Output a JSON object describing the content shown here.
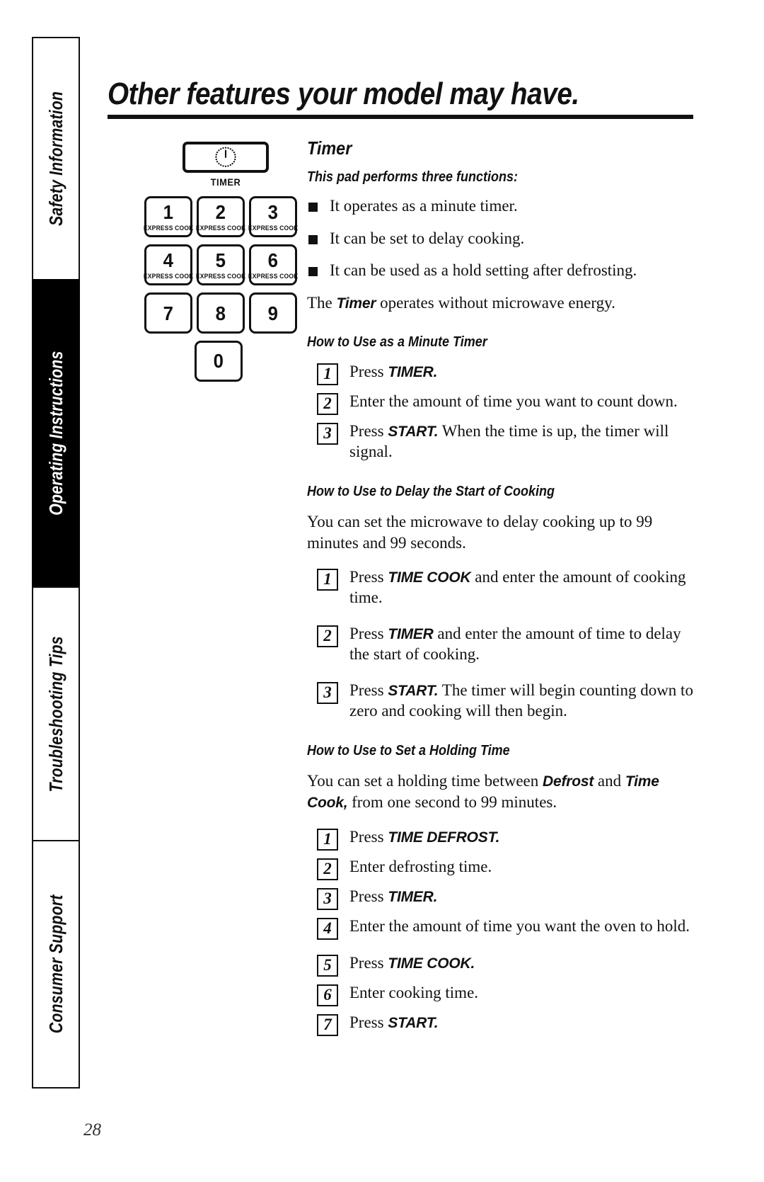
{
  "page": {
    "title": "Other features your model may have.",
    "number": "28"
  },
  "sidebar": {
    "items": [
      {
        "label": "Safety Information",
        "active": false
      },
      {
        "label": "Operating Instructions",
        "active": true
      },
      {
        "label": "Troubleshooting Tips",
        "active": false
      },
      {
        "label": "Consumer Support",
        "active": false
      }
    ]
  },
  "keypad": {
    "timer_key": {
      "icon": "timer-dial-icon",
      "caption": "TIMER"
    },
    "keys": [
      {
        "digit": "1",
        "sub": "EXPRESS COOK"
      },
      {
        "digit": "2",
        "sub": "EXPRESS COOK"
      },
      {
        "digit": "3",
        "sub": "EXPRESS COOK"
      },
      {
        "digit": "4",
        "sub": "EXPRESS COOK"
      },
      {
        "digit": "5",
        "sub": "EXPRESS COOK"
      },
      {
        "digit": "6",
        "sub": "EXPRESS COOK"
      },
      {
        "digit": "7",
        "sub": ""
      },
      {
        "digit": "8",
        "sub": ""
      },
      {
        "digit": "9",
        "sub": ""
      }
    ],
    "zero_key": {
      "digit": "0",
      "sub": ""
    }
  },
  "main": {
    "section_title": "Timer",
    "intro_heading": "This pad performs three functions:",
    "bullets": [
      "It operates as a minute timer.",
      "It can be set to delay cooking.",
      "It can be used as a hold setting after defrosting."
    ],
    "note": {
      "before": "The ",
      "keyword": "Timer",
      "after": " operates without microwave energy."
    },
    "sections": [
      {
        "heading": "How to Use as a Minute Timer",
        "paragraphs": [],
        "steps": [
          {
            "num": "1",
            "before": "Press ",
            "keyword": "TIMER.",
            "after": ""
          },
          {
            "num": "2",
            "before": "Enter the amount of time you want to count down.",
            "keyword": "",
            "after": ""
          },
          {
            "num": "3",
            "before": "Press ",
            "keyword": "START.",
            "after": " When the time is up, the timer will signal."
          }
        ]
      },
      {
        "heading": "How to Use to Delay the Start of Cooking",
        "paragraphs": [
          "You can set the microwave to delay cooking up to 99 minutes and 99 seconds."
        ],
        "steps": [
          {
            "num": "1",
            "before": "Press ",
            "keyword": "TIME COOK",
            "after": "  and enter the amount of cooking time."
          },
          {
            "num": "2",
            "before": "Press ",
            "keyword": "TIMER",
            "after": " and enter the amount of time to delay the start of cooking."
          },
          {
            "num": "3",
            "before": "Press ",
            "keyword": "START.",
            "after": " The timer will begin counting down to zero and cooking will then begin."
          }
        ]
      },
      {
        "heading": "How to Use to Set a Holding Time",
        "paragraphs_rich": {
          "p1_a": "You can set a holding time between ",
          "p1_kw1": "Defrost",
          "p1_b": "  and ",
          "p1_kw2": "Time Cook,",
          "p1_c": " from one second to 99 minutes."
        },
        "steps": [
          {
            "num": "1",
            "before": "Press ",
            "keyword": "TIME DEFROST.",
            "after": ""
          },
          {
            "num": "2",
            "before": "Enter defrosting time.",
            "keyword": "",
            "after": ""
          },
          {
            "num": "3",
            "before": "Press ",
            "keyword": "TIMER.",
            "after": ""
          },
          {
            "num": "4",
            "before": "Enter the amount of time you want the oven to hold.",
            "keyword": "",
            "after": ""
          },
          {
            "num": "5",
            "before": "Press ",
            "keyword": "TIME COOK.",
            "after": ""
          },
          {
            "num": "6",
            "before": "Enter cooking time.",
            "keyword": "",
            "after": ""
          },
          {
            "num": "7",
            "before": "Press ",
            "keyword": "START.",
            "after": ""
          }
        ]
      }
    ]
  }
}
